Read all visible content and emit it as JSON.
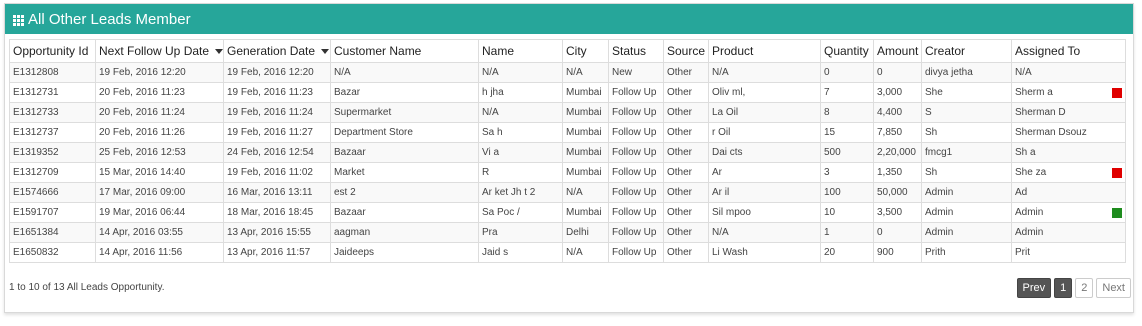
{
  "panel": {
    "title": "All Other Leads Member",
    "accent_color": "#26a69a",
    "icon": "table-grid-icon"
  },
  "table": {
    "columns": [
      "Opportunity Id",
      "Next Follow Up Date",
      "Generation Date",
      "Customer Name",
      "Name",
      "City",
      "Status",
      "Source",
      "Product",
      "Quantity",
      "Amount",
      "Creator",
      "Assigned To"
    ],
    "sortable_columns": [
      "Next Follow Up Date",
      "Generation Date"
    ],
    "rows": [
      {
        "id": "E1312808",
        "next": "19 Feb, 2016 12:20",
        "gen": "19 Feb, 2016 12:20",
        "customer": "N/A",
        "name": "N/A",
        "city": "N/A",
        "status": "New",
        "source": "Other",
        "product": "N/A",
        "qty": "0",
        "amount": "0",
        "creator": "divya jetha",
        "assigned": "N/A",
        "flag": ""
      },
      {
        "id": "E1312731",
        "next": "20 Feb, 2016 11:23",
        "gen": "19 Feb, 2016 11:23",
        "customer": "Bazar",
        "name": "h jha",
        "city": "Mumbai",
        "status": "Follow Up",
        "source": "Other",
        "product": "Oliv ml,",
        "qty": "7",
        "amount": "3,000",
        "creator": "She",
        "assigned": "Sherm a",
        "flag": "#e00000"
      },
      {
        "id": "E1312733",
        "next": "20 Feb, 2016 11:24",
        "gen": "19 Feb, 2016 11:24",
        "customer": "Supermarket",
        "name": "N/A",
        "city": "Mumbai",
        "status": "Follow Up",
        "source": "Other",
        "product": "La Oil",
        "qty": "8",
        "amount": "4,400",
        "creator": "S",
        "assigned": "Sherman D",
        "flag": ""
      },
      {
        "id": "E1312737",
        "next": "20 Feb, 2016 11:26",
        "gen": "19 Feb, 2016 11:27",
        "customer": "Department Store",
        "name": "Sa h",
        "city": "Mumbai",
        "status": "Follow Up",
        "source": "Other",
        "product": "r Oil",
        "qty": "15",
        "amount": "7,850",
        "creator": "Sh",
        "assigned": "Sherman Dsouz",
        "flag": ""
      },
      {
        "id": "E1319352",
        "next": "25 Feb, 2016 12:53",
        "gen": "24 Feb, 2016 12:54",
        "customer": "Bazaar",
        "name": "Vi a",
        "city": "Mumbai",
        "status": "Follow Up",
        "source": "Other",
        "product": "Dai cts",
        "qty": "500",
        "amount": "2,20,000",
        "creator": "fmcg1",
        "assigned": "Sh a",
        "flag": ""
      },
      {
        "id": "E1312709",
        "next": "15 Mar, 2016 14:40",
        "gen": "19 Feb, 2016 11:02",
        "customer": "Market",
        "name": "R",
        "city": "Mumbai",
        "status": "Follow Up",
        "source": "Other",
        "product": "Ar",
        "qty": "3",
        "amount": "1,350",
        "creator": "Sh",
        "assigned": "She za",
        "flag": "#e00000"
      },
      {
        "id": "E1574666",
        "next": "17 Mar, 2016 09:00",
        "gen": "16 Mar, 2016 13:11",
        "customer": "est 2",
        "name": "Ar ket Jh t 2",
        "city": "N/A",
        "status": "Follow Up",
        "source": "Other",
        "product": "Ar il",
        "qty": "100",
        "amount": "50,000",
        "creator": "Admin",
        "assigned": "Ad",
        "flag": ""
      },
      {
        "id": "E1591707",
        "next": "19 Mar, 2016 06:44",
        "gen": "18 Mar, 2016 18:45",
        "customer": "Bazaar",
        "name": "Sa Poc /",
        "city": "Mumbai",
        "status": "Follow Up",
        "source": "Other",
        "product": "Sil mpoo",
        "qty": "10",
        "amount": "3,500",
        "creator": "Admin",
        "assigned": "Admin",
        "flag": "#1e8c1e"
      },
      {
        "id": "E1651384",
        "next": "14 Apr, 2016 03:55",
        "gen": "13 Apr, 2016 15:55",
        "customer": "aagman",
        "name": "Pra",
        "city": "Delhi",
        "status": "Follow Up",
        "source": "Other",
        "product": "N/A",
        "qty": "1",
        "amount": "0",
        "creator": "Admin",
        "assigned": "Admin",
        "flag": ""
      },
      {
        "id": "E1650832",
        "next": "14 Apr, 2016 11:56",
        "gen": "13 Apr, 2016 11:57",
        "customer": "Jaideeps",
        "name": "Jaid s",
        "city": "N/A",
        "status": "Follow Up",
        "source": "Other",
        "product": "Li Wash",
        "qty": "20",
        "amount": "900",
        "creator": "Prith",
        "assigned": "Prit",
        "flag": ""
      }
    ]
  },
  "footer": {
    "info": "1 to 10 of 13 All Leads Opportunity."
  },
  "pagination": {
    "prev": "Prev",
    "pages": [
      "1",
      "2"
    ],
    "current": "1",
    "next": "Next"
  }
}
